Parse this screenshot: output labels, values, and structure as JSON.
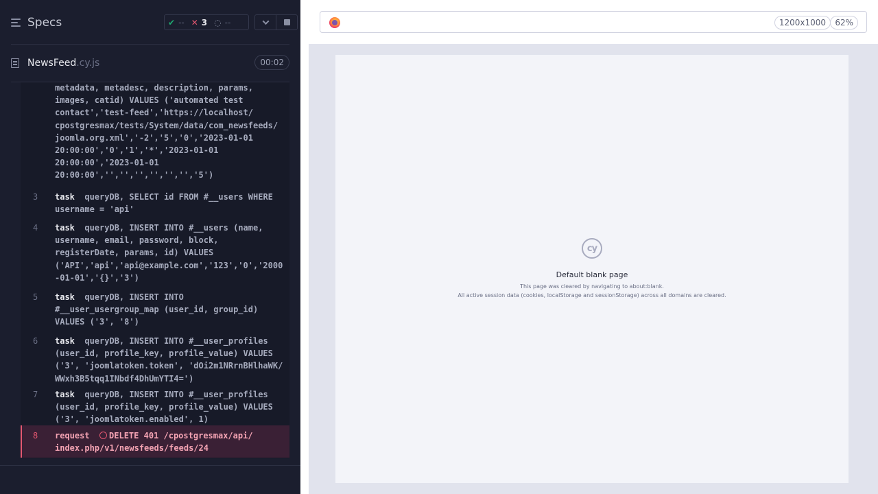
{
  "header": {
    "specs_label": "Specs",
    "passed": "--",
    "failed": "3",
    "pending": "--"
  },
  "spec": {
    "name": "NewsFeed",
    "ext": ".cy.js",
    "duration": "00:02"
  },
  "commands": [
    {
      "num": "",
      "lines": [
        "metadata, metadesc, description, params,",
        "images, catid) VALUES ('automated test",
        "contact','test-feed','https://localhost/",
        "cpostgresmax/tests/System/data/com_newsfeeds/",
        "joomla.org.xml','-2','5','0','2023-01-01",
        "20:00:00','0','1','*','2023-01-01",
        "20:00:00','2023-01-01",
        "20:00:00','','','','','','','5')"
      ]
    },
    {
      "num": "3",
      "kw": "task",
      "lines": [
        "queryDB, SELECT id FROM #__users WHERE",
        "username = 'api'"
      ]
    },
    {
      "num": "4",
      "kw": "task",
      "lines": [
        "queryDB, INSERT INTO #__users (name,",
        "username, email, password, block,",
        "registerDate, params, id) VALUES",
        "('API','api','api@example.com','123','0','2000",
        "-01-01','{}','3')"
      ]
    },
    {
      "num": "5",
      "kw": "task",
      "lines": [
        "queryDB, INSERT INTO",
        "#__user_usergroup_map (user_id, group_id)",
        "VALUES ('3', '8')"
      ]
    },
    {
      "num": "6",
      "kw": "task",
      "lines": [
        "queryDB, INSERT INTO #__user_profiles",
        "(user_id, profile_key, profile_value) VALUES",
        "('3', 'joomlatoken.token', 'dOi2m1NRrnBHlhaWK/",
        "WWxh3B5tqq1INbdf4DhUmYTI4=')"
      ]
    },
    {
      "num": "7",
      "kw": "task",
      "lines": [
        "queryDB, INSERT INTO #__user_profiles",
        "(user_id, profile_key, profile_value) VALUES",
        "('3', 'joomlatoken.enabled', 1)"
      ]
    },
    {
      "num": "8",
      "kw": "request",
      "error": true,
      "lines": [
        "DELETE 401 /cpostgresmax/api/",
        "index.php/v1/newsfeeds/feeds/24"
      ]
    }
  ],
  "aut": {
    "viewport_size": "1200x1000",
    "zoom": "62%",
    "logo_text": "cy",
    "blank_title": "Default blank page",
    "blank_line1": "This page was cleared by navigating to about:blank.",
    "blank_line2": "All active session data (cookies, localStorage and sessionStorage) across all domains are cleared."
  },
  "colors": {
    "reporter_bg": "#1b1e2e",
    "pass": "#1fa971",
    "fail": "#e45770"
  }
}
